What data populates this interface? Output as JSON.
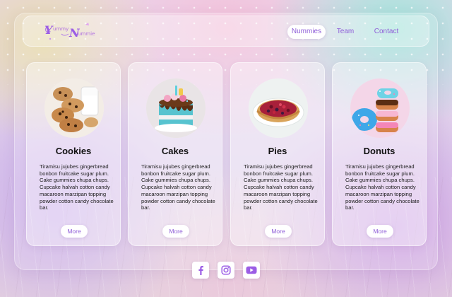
{
  "brand": {
    "logo_text": "Yummy Nummies",
    "logo_color": "#9b5de5"
  },
  "nav": {
    "items": [
      {
        "label": "Nummies",
        "active": true
      },
      {
        "label": "Team",
        "active": false
      },
      {
        "label": "Contact",
        "active": false
      }
    ]
  },
  "cards": [
    {
      "title": "Cookies",
      "image_icon": "cookies-image",
      "description": "Tiramisu jujubes gingerbread bonbon fruitcake sugar plum. Cake gummies chupa chups. Cupcake halvah cotton candy macaroon marzipan topping powder cotton candy chocolate bar.",
      "button_label": "More"
    },
    {
      "title": "Cakes",
      "image_icon": "cake-image",
      "description": "Tiramisu jujubes gingerbread bonbon fruitcake sugar plum. Cake gummies chupa chups. Cupcake halvah cotton candy macaroon marzipan topping powder cotton candy chocolate bar.",
      "button_label": "More"
    },
    {
      "title": "Pies",
      "image_icon": "pie-image",
      "description": "Tiramisu jujubes gingerbread bonbon fruitcake sugar plum. Cake gummies chupa chups. Cupcake halvah cotton candy macaroon marzipan topping powder cotton candy chocolate bar.",
      "button_label": "More"
    },
    {
      "title": "Donuts",
      "image_icon": "donuts-image",
      "description": "Tiramisu jujubes gingerbread bonbon fruitcake sugar plum. Cake gummies chupa chups. Cupcake halvah cotton candy macaroon marzipan topping powder cotton candy chocolate bar.",
      "button_label": "More"
    }
  ],
  "footer": {
    "social_icons": [
      "facebook-icon",
      "instagram-icon",
      "youtube-icon"
    ]
  },
  "colors": {
    "accent": "#8f5ed8",
    "social_icon": "#9b5de5"
  }
}
